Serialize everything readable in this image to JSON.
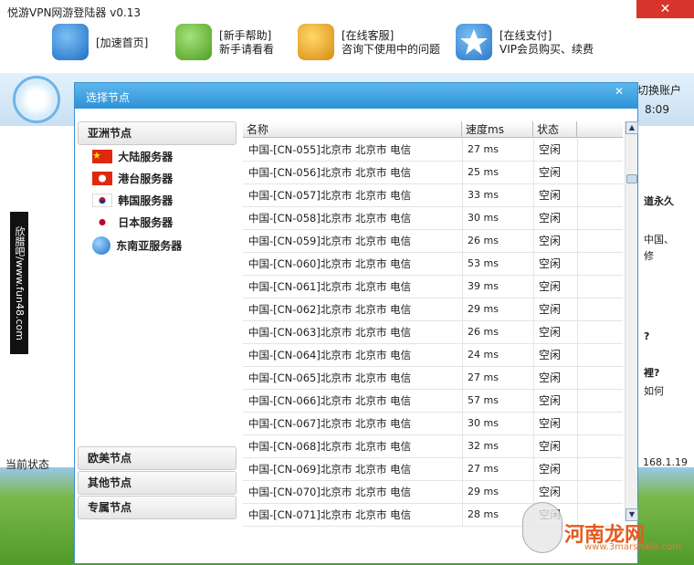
{
  "app": {
    "title": "悦游VPN网游登陆器 v0.13",
    "close_glyph": "✕"
  },
  "toolbar": {
    "items": [
      {
        "line1": "[加速首页]",
        "line2": "",
        "icon": "globe-icon",
        "color": "#1f6fc4"
      },
      {
        "line1": "[新手帮助]",
        "line2": "新手请看看",
        "icon": "android-icon",
        "color": "#5fb52d"
      },
      {
        "line1": "[在线客服]",
        "line2": "咨询下使用中的问题",
        "icon": "graduate-icon",
        "color": "#e8a21b"
      },
      {
        "line1": "[在线支付]",
        "line2": "VIP会员购买、续费",
        "icon": "star-icon",
        "color": "#2a77c8"
      }
    ]
  },
  "background": {
    "switch_account": "切换账户",
    "time": "8:09",
    "status_label": "当前状态",
    "ip_fragment": "168.1.19",
    "right_texts": [
      "道永久",
      "中国、",
      "修",
      "?",
      "裡?",
      "如何"
    ]
  },
  "watermark_left": "欣腊吧/www.fun48.com",
  "brand_watermark": {
    "main": "河南龙网",
    "sub": "www.3marshalls.com"
  },
  "dialog": {
    "title": "选择节点",
    "close_glyph": "✕",
    "groups": {
      "asia": "亚洲节点",
      "euro_us": "欧美节点",
      "other": "其他节点",
      "exclusive": "专属节点"
    },
    "servers": [
      {
        "label": "大陆服务器",
        "flag": "cn-flag-icon"
      },
      {
        "label": "港台服务器",
        "flag": "hk-flag-icon"
      },
      {
        "label": "韩国服务器",
        "flag": "kr-flag-icon"
      },
      {
        "label": "日本服务器",
        "flag": "jp-flag-icon"
      },
      {
        "label": "东南亚服务器",
        "flag": "globe-icon"
      }
    ],
    "table": {
      "headers": {
        "name": "名称",
        "speed": "速度ms",
        "state": "状态"
      },
      "rows": [
        {
          "name": "中国-[CN-055]北京市 北京市 电信",
          "speed": "27 ms",
          "state": "空闲"
        },
        {
          "name": "中国-[CN-056]北京市 北京市 电信",
          "speed": "25 ms",
          "state": "空闲"
        },
        {
          "name": "中国-[CN-057]北京市 北京市 电信",
          "speed": "33 ms",
          "state": "空闲"
        },
        {
          "name": "中国-[CN-058]北京市 北京市 电信",
          "speed": "30 ms",
          "state": "空闲"
        },
        {
          "name": "中国-[CN-059]北京市 北京市 电信",
          "speed": "26 ms",
          "state": "空闲"
        },
        {
          "name": "中国-[CN-060]北京市 北京市 电信",
          "speed": "53 ms",
          "state": "空闲"
        },
        {
          "name": "中国-[CN-061]北京市 北京市 电信",
          "speed": "39 ms",
          "state": "空闲"
        },
        {
          "name": "中国-[CN-062]北京市 北京市 电信",
          "speed": "29 ms",
          "state": "空闲"
        },
        {
          "name": "中国-[CN-063]北京市 北京市 电信",
          "speed": "26 ms",
          "state": "空闲"
        },
        {
          "name": "中国-[CN-064]北京市 北京市 电信",
          "speed": "24 ms",
          "state": "空闲"
        },
        {
          "name": "中国-[CN-065]北京市 北京市 电信",
          "speed": "27 ms",
          "state": "空闲"
        },
        {
          "name": "中国-[CN-066]北京市 北京市 电信",
          "speed": "57 ms",
          "state": "空闲"
        },
        {
          "name": "中国-[CN-067]北京市 北京市 电信",
          "speed": "30 ms",
          "state": "空闲"
        },
        {
          "name": "中国-[CN-068]北京市 北京市 电信",
          "speed": "32 ms",
          "state": "空闲"
        },
        {
          "name": "中国-[CN-069]北京市 北京市 电信",
          "speed": "27 ms",
          "state": "空闲"
        },
        {
          "name": "中国-[CN-070]北京市 北京市 电信",
          "speed": "29 ms",
          "state": "空闲"
        },
        {
          "name": "中国-[CN-071]北京市 北京市 电信",
          "speed": "28 ms",
          "state": "空闲"
        }
      ]
    }
  }
}
